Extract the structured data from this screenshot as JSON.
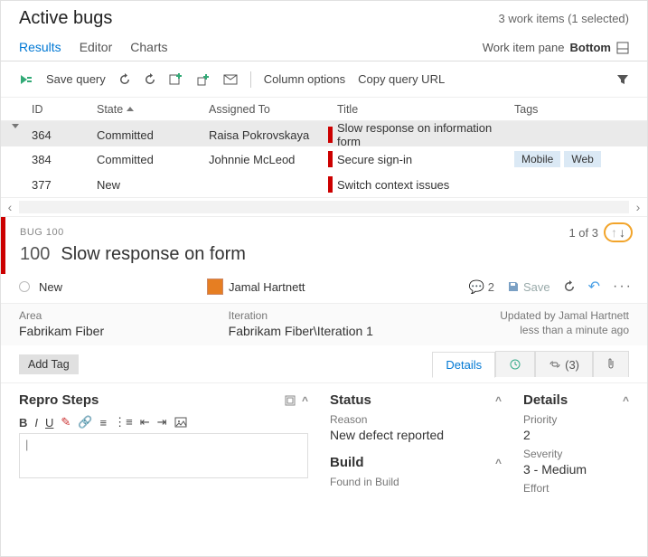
{
  "header": {
    "title": "Active bugs",
    "subtitle": "3 work items (1 selected)"
  },
  "tabs": {
    "items": [
      "Results",
      "Editor",
      "Charts"
    ],
    "active": 0
  },
  "pane": {
    "label": "Work item pane",
    "value": "Bottom"
  },
  "toolbar": {
    "save_query": "Save query",
    "column_options": "Column options",
    "copy_url": "Copy query URL"
  },
  "columns": [
    "ID",
    "State",
    "Assigned To",
    "Title",
    "Tags"
  ],
  "rows": [
    {
      "id": "364",
      "state": "Committed",
      "assigned": "Raisa Pokrovskaya",
      "title": "Slow response on information form",
      "tags": [],
      "selected": true
    },
    {
      "id": "384",
      "state": "Committed",
      "assigned": "Johnnie McLeod",
      "title": "Secure sign-in",
      "tags": [
        "Mobile",
        "Web"
      ],
      "selected": false
    },
    {
      "id": "377",
      "state": "New",
      "assigned": "",
      "title": "Switch context issues",
      "tags": [],
      "selected": false
    }
  ],
  "detail": {
    "bug_label": "BUG 100",
    "id": "100",
    "title": "Slow response on form",
    "state": "New",
    "assignee": "Jamal Hartnett",
    "counter": "1 of 3",
    "comments": "2",
    "save_label": "Save",
    "area_label": "Area",
    "area_value": "Fabrikam Fiber",
    "iter_label": "Iteration",
    "iter_value": "Fabrikam Fiber\\Iteration 1",
    "updated_by": "Updated by Jamal Hartnett",
    "updated_when": "less than a minute ago",
    "add_tag": "Add Tag",
    "tabs": {
      "details": "Details",
      "links": "(3)"
    },
    "repro": {
      "heading": "Repro Steps",
      "placeholder": "|"
    },
    "status": {
      "heading": "Status",
      "reason_label": "Reason",
      "reason_value": "New defect reported",
      "build_heading": "Build",
      "found_label": "Found in Build"
    },
    "right": {
      "heading": "Details",
      "priority_label": "Priority",
      "priority_value": "2",
      "severity_label": "Severity",
      "severity_value": "3 - Medium",
      "effort_label": "Effort"
    }
  }
}
